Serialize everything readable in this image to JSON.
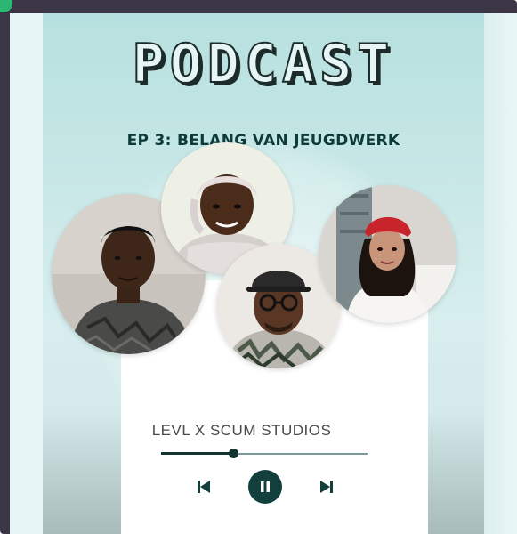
{
  "poster": {
    "title": "PODCAST",
    "subtitle": "EP 3: BELANG VAN JEUGDWERK",
    "credit": "LEVL X SCUM STUDIOS"
  },
  "player": {
    "progress": 0.35,
    "controls": {
      "previous_icon": "skip-previous-icon",
      "pause_icon": "pause-icon",
      "next_icon": "skip-next-icon"
    }
  },
  "colors": {
    "frame": "#3b3546",
    "accent": "#2bb673",
    "background": "#e6f5f5",
    "teal_dark": "#13403c",
    "subtitle": "#0d3b3a"
  }
}
